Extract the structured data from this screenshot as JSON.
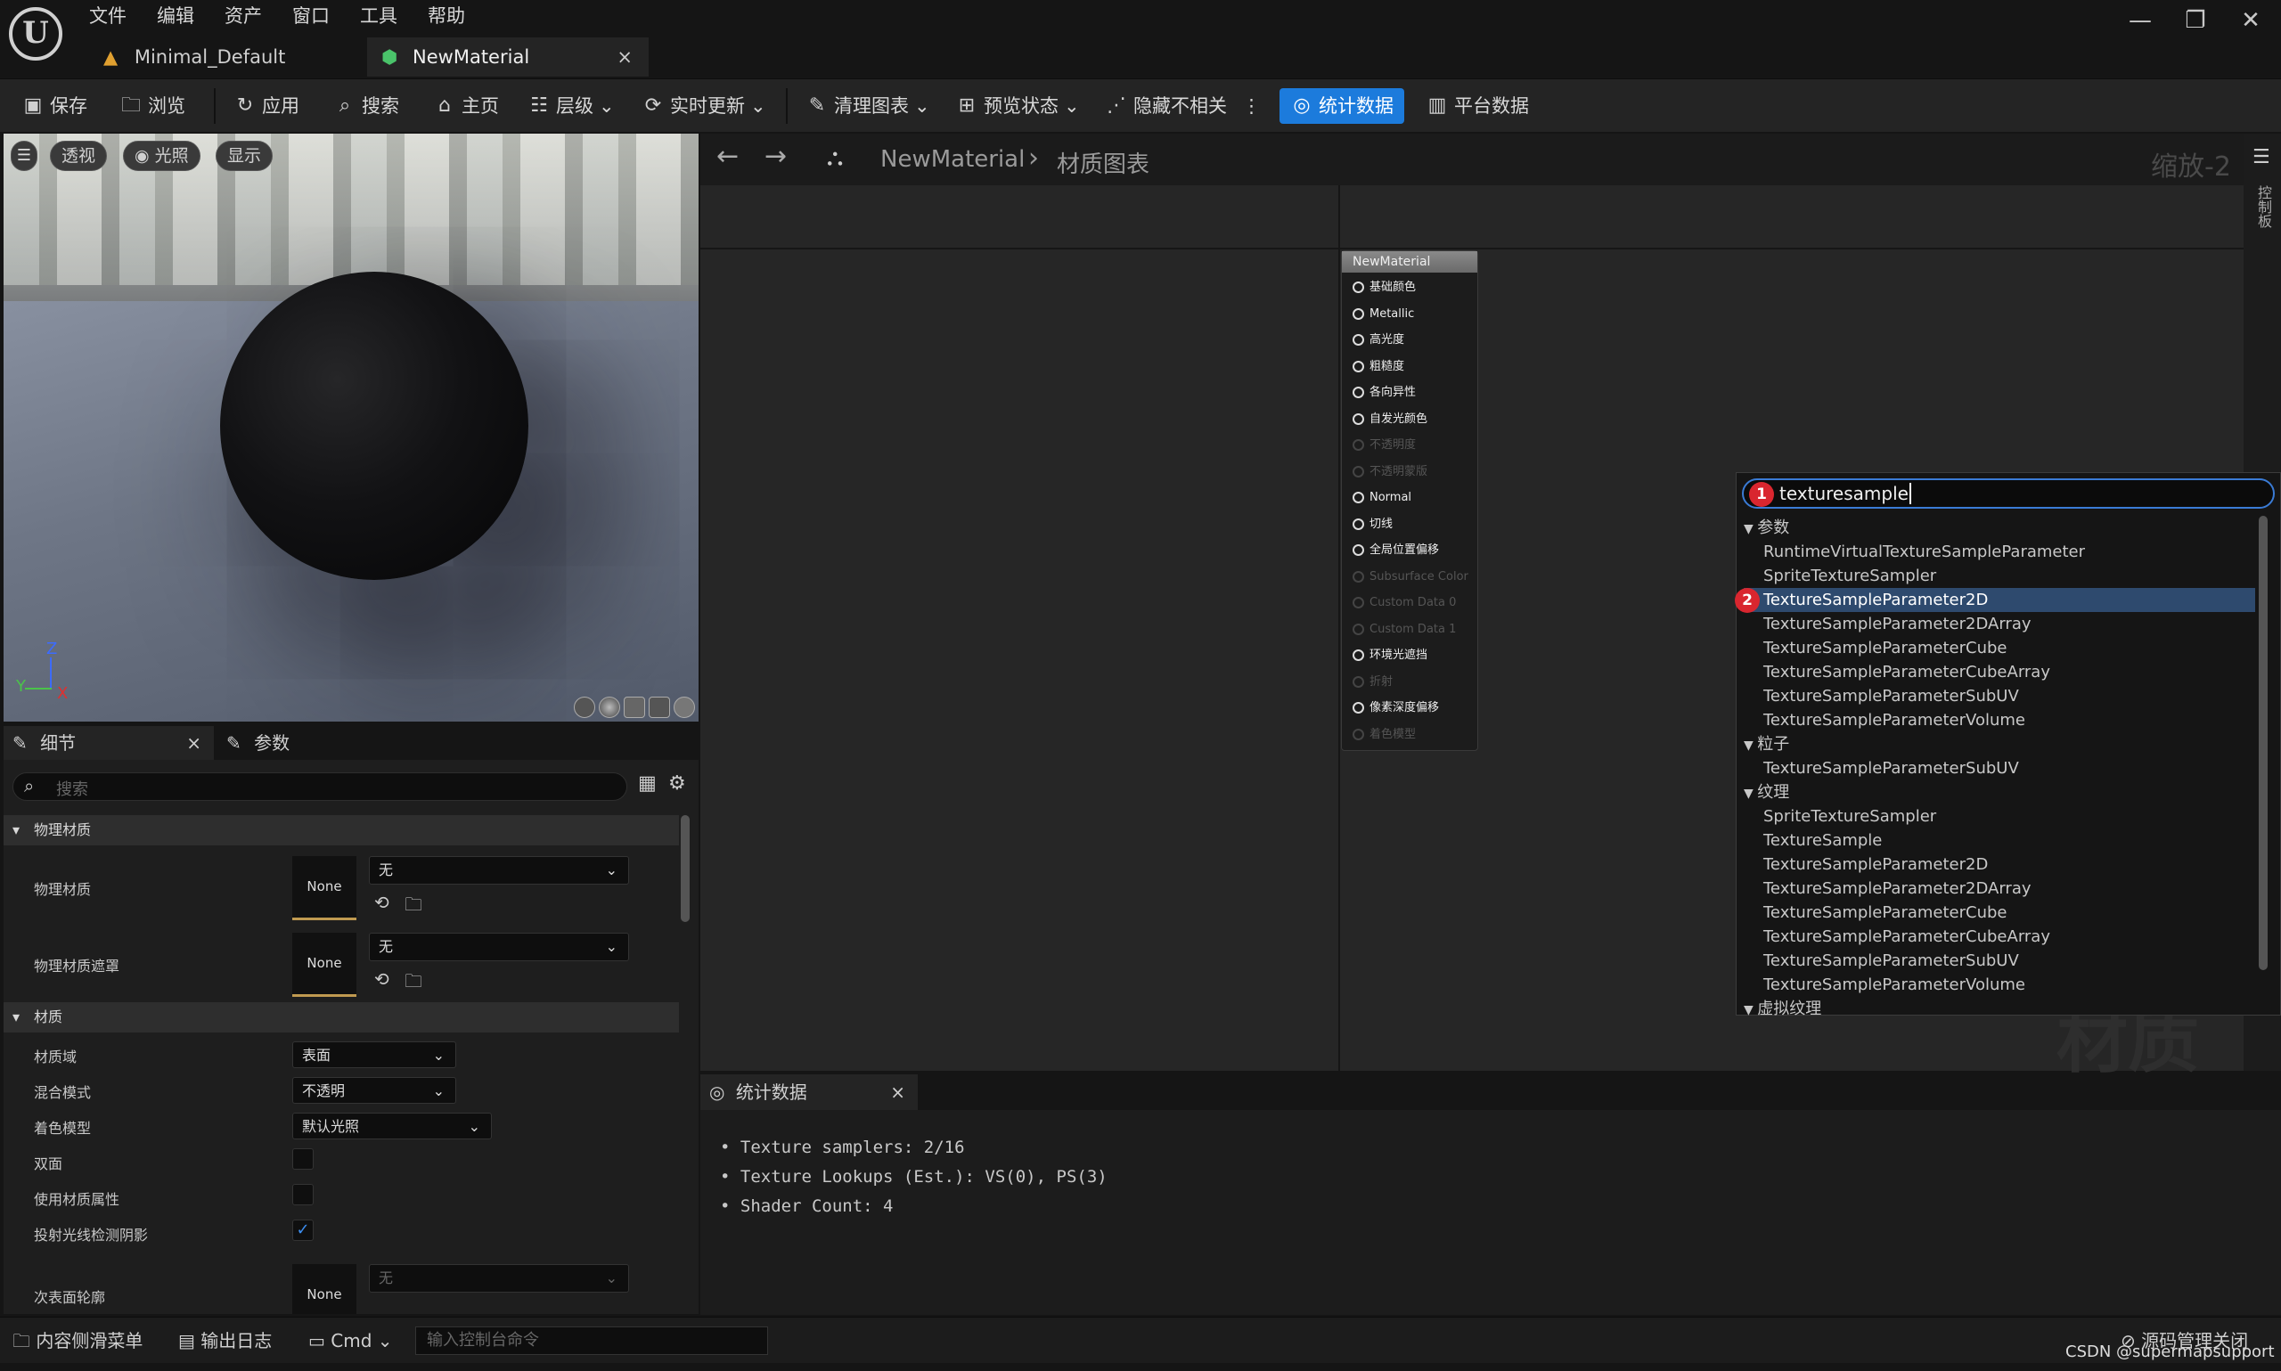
{
  "menu": [
    "文件",
    "编辑",
    "资产",
    "窗口",
    "工具",
    "帮助"
  ],
  "logo_letter": "U",
  "window_controls": {
    "minimize": "—",
    "restore": "❐",
    "close": "✕"
  },
  "tabs": [
    {
      "label": "Minimal_Default",
      "icon": "level-icon"
    },
    {
      "label": "NewMaterial",
      "icon": "material-icon",
      "close": "×"
    }
  ],
  "toolbar": {
    "save": "保存",
    "browse": "浏览",
    "apply": "应用",
    "search": "搜索",
    "home": "主页",
    "hierarchy": "层级",
    "live_update": "实时更新",
    "clean_graph": "清理图表",
    "preview_state": "预览状态",
    "hide_unrelated": "隐藏不相关",
    "more": "⋮",
    "stats": "统计数据",
    "platform_stats": "平台数据"
  },
  "viewport": {
    "perspective": "透视",
    "lit": "光照",
    "show": "显示",
    "axis_z": "Z",
    "axis_x": "X",
    "axis_y": "Y"
  },
  "details": {
    "tab_details": "细节",
    "tab_close": "×",
    "tab_params": "参数",
    "search_placeholder": "搜索",
    "sec_phys": "物理材质",
    "phys_material": "物理材质",
    "phys_mask": "物理材质遮罩",
    "none": "None",
    "wu": "无",
    "sec_material": "材质",
    "domain_label": "材质域",
    "domain_value": "表面",
    "blend_label": "混合模式",
    "blend_value": "不透明",
    "shading_label": "着色模型",
    "shading_value": "默认光照",
    "two_sided": "双面",
    "use_attr": "使用材质属性",
    "cast_ray": "投射光线检测阴影",
    "subsurface": "次表面轮廓"
  },
  "graph": {
    "back": "←",
    "forward": "→",
    "crumb_material": "NewMaterial",
    "crumb_sep": "›",
    "crumb_graph": "材质图表",
    "zoom": "缩放-2",
    "palette": "控制板",
    "watermark": "材质"
  },
  "node": {
    "title": "NewMaterial",
    "pins": [
      {
        "label": "基础颜色",
        "enabled": true
      },
      {
        "label": "Metallic",
        "enabled": true
      },
      {
        "label": "高光度",
        "enabled": true
      },
      {
        "label": "粗糙度",
        "enabled": true
      },
      {
        "label": "各向异性",
        "enabled": true
      },
      {
        "label": "自发光颜色",
        "enabled": true
      },
      {
        "label": "不透明度",
        "enabled": false
      },
      {
        "label": "不透明蒙版",
        "enabled": false
      },
      {
        "label": "Normal",
        "enabled": true
      },
      {
        "label": "切线",
        "enabled": true
      },
      {
        "label": "全局位置偏移",
        "enabled": true
      },
      {
        "label": "Subsurface Color",
        "enabled": false
      },
      {
        "label": "Custom Data 0",
        "enabled": false
      },
      {
        "label": "Custom Data 1",
        "enabled": false
      },
      {
        "label": "环境光遮挡",
        "enabled": true
      },
      {
        "label": "折射",
        "enabled": false
      },
      {
        "label": "像素深度偏移",
        "enabled": true
      },
      {
        "label": "着色模型",
        "enabled": false
      }
    ]
  },
  "popup": {
    "query": "texturesample",
    "badge1": "1",
    "badge2": "2",
    "cat_params": "参数",
    "params": [
      "RuntimeVirtualTextureSampleParameter",
      "SpriteTextureSampler",
      "TextureSampleParameter2D",
      "TextureSampleParameter2DArray",
      "TextureSampleParameterCube",
      "TextureSampleParameterCubeArray",
      "TextureSampleParameterSubUV",
      "TextureSampleParameterVolume"
    ],
    "cat_particles": "粒子",
    "particles": [
      "TextureSampleParameterSubUV"
    ],
    "cat_texture": "纹理",
    "texture": [
      "SpriteTextureSampler",
      "TextureSample",
      "TextureSampleParameter2D",
      "TextureSampleParameter2DArray",
      "TextureSampleParameterCube",
      "TextureSampleParameterCubeArray",
      "TextureSampleParameterSubUV",
      "TextureSampleParameterVolume"
    ],
    "cat_virtual": "虚拟纹理",
    "selected": "TextureSampleParameter2D"
  },
  "stats": {
    "tab": "统计数据",
    "close": "×",
    "lines": [
      "Texture samplers: 2/16",
      "Texture Lookups (Est.): VS(0), PS(3)",
      "Shader Count: 4"
    ]
  },
  "statusbar": {
    "content_drawer": "内容侧滑菜单",
    "output_log": "输出日志",
    "cmd": "Cmd",
    "console_placeholder": "输入控制台命令",
    "source_control": "源码管理关闭",
    "credit": "CSDN @supermapsupport"
  },
  "colors": {
    "accent": "#1c7bdc",
    "selection": "#2e4a6e",
    "badge": "#d9262f"
  }
}
